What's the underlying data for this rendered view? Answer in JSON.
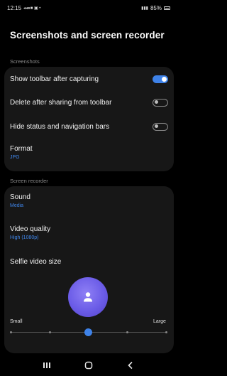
{
  "status_bar": {
    "time": "12:15",
    "battery": "85%"
  },
  "title": "Screenshots and screen recorder",
  "screenshots": {
    "section_label": "Screenshots",
    "show_toolbar": {
      "label": "Show toolbar after capturing",
      "on": true
    },
    "delete_after_sharing": {
      "label": "Delete after sharing from toolbar",
      "on": false
    },
    "hide_bars": {
      "label": "Hide status and navigation bars",
      "on": false
    },
    "format": {
      "label": "Format",
      "value": "JPG"
    }
  },
  "screen_recorder": {
    "section_label": "Screen recorder",
    "sound": {
      "label": "Sound",
      "value": "Media"
    },
    "video_quality": {
      "label": "Video quality",
      "value": "High (1080p)"
    },
    "selfie_video_size": {
      "label": "Selfie video size",
      "min_label": "Small",
      "max_label": "Large",
      "level": 0.5
    }
  },
  "colors": {
    "accent": "#3e82e8",
    "card": "#171717",
    "avatar": "#6b5ce7"
  },
  "icons": [
    "person-icon",
    "recents-icon",
    "home-icon",
    "back-icon"
  ]
}
